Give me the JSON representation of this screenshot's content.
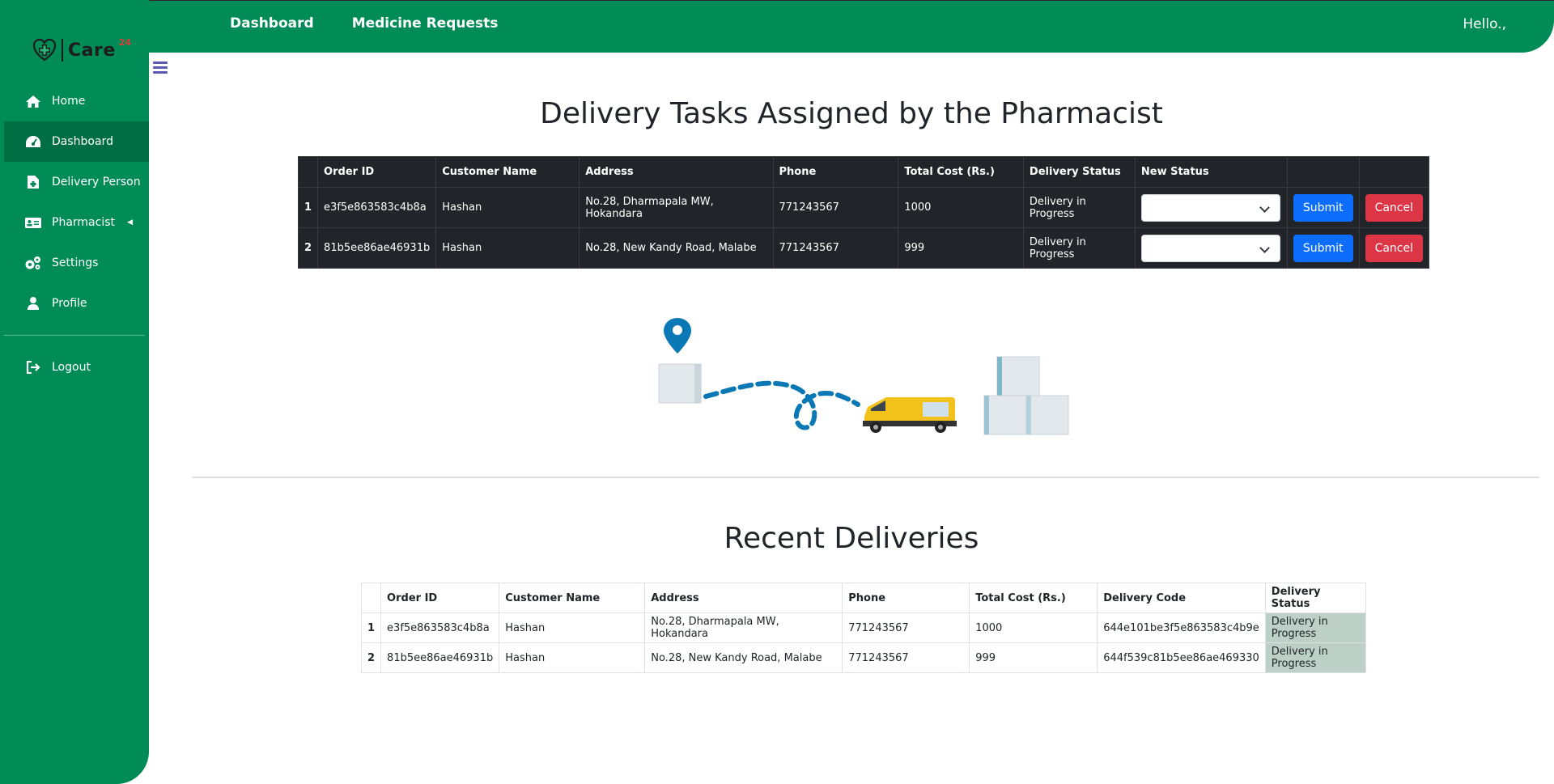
{
  "brand": {
    "name": "Care",
    "sup": "24"
  },
  "topbar": {
    "links": [
      "Dashboard",
      "Medicine Requests"
    ],
    "greeting": "Hello.,"
  },
  "sidebar": {
    "items": [
      {
        "label": "Home",
        "icon": "home-icon"
      },
      {
        "label": "Dashboard",
        "icon": "dashboard-icon",
        "active": true
      },
      {
        "label": "Delivery Person",
        "icon": "file-icon"
      },
      {
        "label": "Pharmacist",
        "icon": "id-card-icon"
      },
      {
        "label": "Settings",
        "icon": "gears-icon"
      },
      {
        "label": "Profile",
        "icon": "user-icon"
      }
    ],
    "logout": "Logout"
  },
  "tasks": {
    "title": "Delivery Tasks Assigned by the Pharmacist",
    "headers": [
      "Order ID",
      "Customer Name",
      "Address",
      "Phone",
      "Total Cost (Rs.)",
      "Delivery Status",
      "New Status"
    ],
    "rows": [
      {
        "idx": "1",
        "order_id": "e3f5e863583c4b8a",
        "customer": "Hashan",
        "address": "No.28, Dharmapala MW, Hokandara",
        "phone": "771243567",
        "cost": "1000",
        "status": "Delivery in Progress"
      },
      {
        "idx": "2",
        "order_id": "81b5ee86ae46931b",
        "customer": "Hashan",
        "address": "No.28, New Kandy Road, Malabe",
        "phone": "771243567",
        "cost": "999",
        "status": "Delivery in Progress"
      }
    ],
    "submit_label": "Submit",
    "cancel_label": "Cancel"
  },
  "recent": {
    "title": "Recent Deliveries",
    "headers": [
      "Order ID",
      "Customer Name",
      "Address",
      "Phone",
      "Total Cost (Rs.)",
      "Delivery Code",
      "Delivery Status"
    ],
    "rows": [
      {
        "idx": "1",
        "order_id": "e3f5e863583c4b8a",
        "customer": "Hashan",
        "address": "No.28, Dharmapala MW, Hokandara",
        "phone": "771243567",
        "cost": "1000",
        "code": "644e101be3f5e863583c4b9e",
        "status": "Delivery in Progress"
      },
      {
        "idx": "2",
        "order_id": "81b5ee86ae46931b",
        "customer": "Hashan",
        "address": "No.28, New Kandy Road, Malabe",
        "phone": "771243567",
        "cost": "999",
        "code": "644f539c81b5ee86ae469330",
        "status": "Delivery in Progress"
      }
    ]
  },
  "colors": {
    "primary": "#008b57",
    "dark_table": "#212529",
    "submit": "#0d6efd",
    "cancel": "#dc3545",
    "status_cell": "#bcd0c7"
  }
}
